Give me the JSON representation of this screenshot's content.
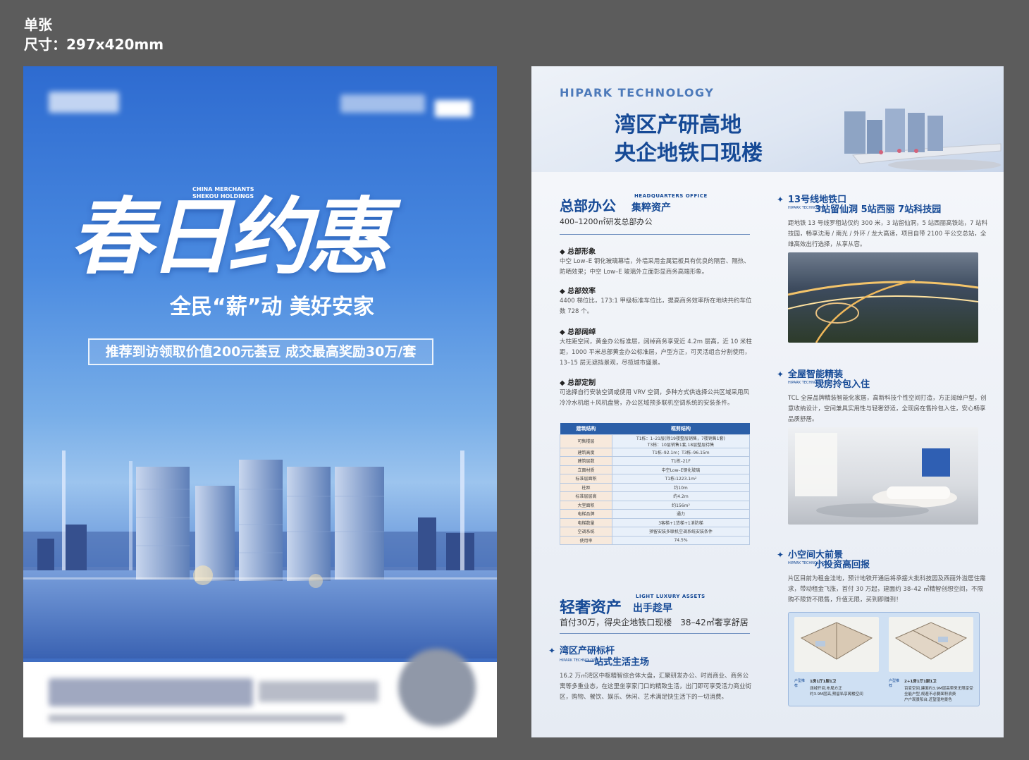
{
  "header": {
    "line1": "单张",
    "line2": "尺寸：297x420mm"
  },
  "front": {
    "brand_en": "CHINA MERCHANTS SHEKOU HOLDINGS",
    "headline": "春日约惠",
    "slogan": "全民“薪”动 美好安家",
    "offer_banner": "推荐到访领取价值200元荟豆 成交最高奖励30万/套"
  },
  "back": {
    "brand_en": "HIPARK TECHNOLOGY",
    "title_line1": "湾区产研高地",
    "title_line2": "央企地铁口现楼",
    "hq": {
      "title": "总部办公",
      "title_en": "HEADQUARTERS OFFICE",
      "title_tag": "集粹资产",
      "subtitle": "400–1200㎡研发总部办公",
      "items": [
        {
          "heading": "总部形象",
          "text": "中空 Low–E 钢化玻璃幕墙，外墙采用金属铝板具有优良的隔音、隔热、防晒效果；中空 Low–E 玻璃外立面彰显商务高端形象。"
        },
        {
          "heading": "总部效率",
          "text": "4400 梯位比，173:1 甲级标准车位比，提高商务效率所在地块共约车位数 728 个。"
        },
        {
          "heading": "总部阔绰",
          "text": "大柱距空间，黄金办公标准层，阔绰商务享受近 4.2m 层高，近 10 米柱距，1000 平米总部黄金办公标准层，户型方正，可灵活组合分割使用，13–15 层无遮挡景观，尽揽城市盛景。"
        },
        {
          "heading": "总部定制",
          "text": "可选择自行安装空调或使用 VRV 空调，多种方式供选择公共区域采用风冷冷水机组＋风机盘管，办公区域预多联机空调系统的安装条件。"
        }
      ]
    },
    "table": {
      "head": [
        "建筑结构",
        "框剪结构"
      ],
      "rows": [
        [
          "可售楼层",
          "T1栋：1–21层(除19楼整层销售，7楼销售1套)\nT3栋：10层销售1套,18层整层待售"
        ],
        [
          "建筑高度",
          "T1栋–92.1m；T3栋–96.15m"
        ],
        [
          "建筑层数",
          "T1栋–21F"
        ],
        [
          "立面材质",
          "中空Low–E钢化玻璃"
        ],
        [
          "标准层面积",
          "T1栋:1223.1m²"
        ],
        [
          "柱距",
          "约10m"
        ],
        [
          "标准层层高",
          "约4.2m"
        ],
        [
          "大堂面积",
          "约156m²"
        ],
        [
          "电梯品牌",
          "通力"
        ],
        [
          "电梯数量",
          "3客梯+1货梯+1消防梯"
        ],
        [
          "空调系统",
          "预留安装多联机空调系统安装条件"
        ],
        [
          "使用率",
          "74.5%"
        ]
      ]
    },
    "luxury": {
      "title": "轻奢资产",
      "title_en": "LIGHT LUXURY ASSETS",
      "title_tag": "出手趁早",
      "subtitle": "首付30万，得央企地铁口现楼　38–42㎡奢享舒居"
    },
    "bay": {
      "line1": "湾区产研标杆",
      "line2": "一站式生活主场",
      "tag": "HIPARK TECHNOLOGY",
      "text": "16.2 万㎡湾区中枢精智综合体大盘，汇聚研发办公、时尚商业、商务公寓等多重业态，在这里坐享家门口的精致生活，出门即可享受活力商业街区，购物、餐饮、娱乐、休闲、艺术满足快生活下的一切消费。"
    },
    "metro": {
      "line1": "13号线地铁口",
      "line2": "3站留仙洞 5站西丽 7站科技园",
      "tag": "HIPARK TECHNOLOGY",
      "text": "距地铁 13 号线罗租站仅约 300 米，3 站留仙洞，5 站西丽高铁站，7 站科技园，畅享沈海 / 南光 / 外环 / 龙大高速，项目自带 2100 平公交总站，全维高效出行选择，从享从容。"
    },
    "smart": {
      "line1": "全屋智能精装",
      "line2": "现房拎包入住",
      "tag": "HIPARK TECHNOLOGY",
      "text": "TCL 全屋品牌精装智能化家居，高新科技个性空间打造，方正阔绰户型，创意收纳设计，空间兼具实用性与轻奢舒适，全现房在售拎包入住，安心畅享品质舒居。"
    },
    "small": {
      "line1": "小空间大前景",
      "line2": "小投资高回报",
      "tag": "HIPARK TECHNOLOGY",
      "text": "片区目前为租金洼地，预计地铁开通后将承接大批科技园及西丽外溢居住需求，带动租金飞涨，首付 30 万起，建面约 38–42 ㎡精智创想空间，不限购不限贷不限售，升值无限，买到即赚到！",
      "plans": [
        {
          "tag": "户型推荐",
          "title": "1房1厅1厨1卫",
          "note": "阔绰开间,布局方正\n约3.9M层高,预留私享阁楼空间"
        },
        {
          "tag": "户型推荐",
          "title": "2+1房1厅1厨1卫",
          "note": "百变空间,建面约3.9M层高带来无限享受\n全能户型,规避不必要面积浪费\n户户观景阳台,近望湿地景色"
        }
      ]
    }
  },
  "colors": {
    "brand_blue": "#164a96",
    "page_bg": "#5c5c5c"
  }
}
